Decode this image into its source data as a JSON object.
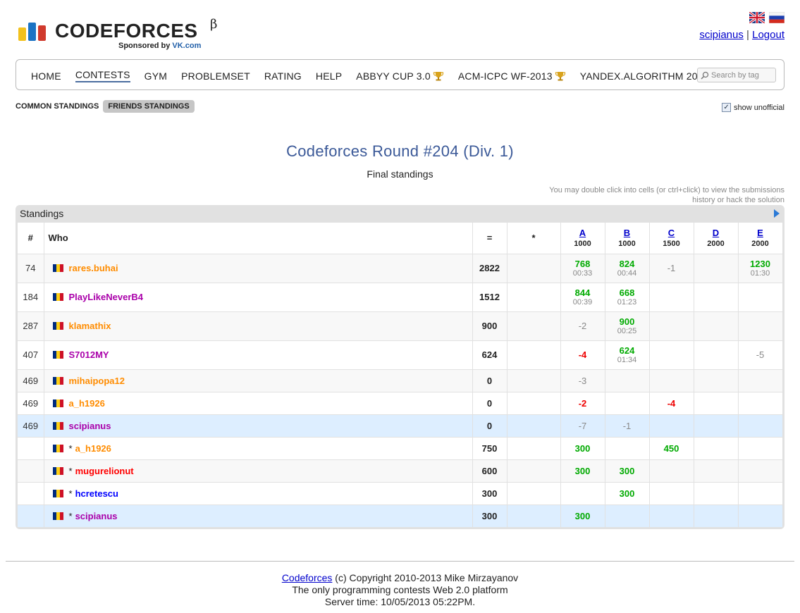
{
  "header": {
    "logo_text": "CODEFORCES",
    "logo_beta": "β",
    "sponsor_prefix": "Sponsored by ",
    "sponsor_brand": "VK.com",
    "user": "scipianus",
    "separator": "|",
    "logout": "Logout"
  },
  "nav": {
    "items": [
      "HOME",
      "CONTESTS",
      "GYM",
      "PROBLEMSET",
      "RATING",
      "HELP",
      "ABBYY CUP 3.0",
      "ACM-ICPC WF-2013",
      "YANDEX.ALGORITHM 2013"
    ],
    "search_placeholder": "Search by tag"
  },
  "subtabs": {
    "common": "COMMON STANDINGS",
    "friends": "FRIENDS STANDINGS",
    "show_unofficial": "show unofficial",
    "checked_mark": "✓"
  },
  "contest": {
    "title": "Codeforces Round #204 (Div. 1)",
    "subtitle": "Final standings",
    "hint": "You may double click into cells (or ctrl+click) to view the submissions history or hack the solution"
  },
  "standings": {
    "box_title": "Standings",
    "headers": {
      "rank": "#",
      "who": "Who",
      "score": "=",
      "hacks": "*",
      "problems": [
        {
          "letter": "A",
          "points": "1000"
        },
        {
          "letter": "B",
          "points": "1000"
        },
        {
          "letter": "C",
          "points": "1500"
        },
        {
          "letter": "D",
          "points": "2000"
        },
        {
          "letter": "E",
          "points": "2000"
        }
      ]
    },
    "rows": [
      {
        "rank": "74",
        "prefix": "",
        "handle": "rares.buhai",
        "score": "2822",
        "hacks": "",
        "cells": [
          {
            "v": "768",
            "t": "00:33"
          },
          {
            "v": "824",
            "t": "00:44"
          },
          {
            "v": "-1"
          },
          {
            "v": ""
          },
          {
            "v": "1230",
            "t": "01:30"
          }
        ]
      },
      {
        "rank": "184",
        "prefix": "",
        "handle": "PlayLikeNeverB4",
        "score": "1512",
        "hacks": "",
        "cells": [
          {
            "v": "844",
            "t": "00:39"
          },
          {
            "v": "668",
            "t": "01:23"
          },
          {
            "v": ""
          },
          {
            "v": ""
          },
          {
            "v": ""
          }
        ]
      },
      {
        "rank": "287",
        "prefix": "",
        "handle": "klamathix",
        "score": "900",
        "hacks": "",
        "cells": [
          {
            "v": "-2"
          },
          {
            "v": "900",
            "t": "00:25"
          },
          {
            "v": ""
          },
          {
            "v": ""
          },
          {
            "v": ""
          }
        ]
      },
      {
        "rank": "407",
        "prefix": "",
        "handle": "S7012MY",
        "score": "624",
        "hacks": "",
        "cells": [
          {
            "v": "-4"
          },
          {
            "v": "624",
            "t": "01:34"
          },
          {
            "v": ""
          },
          {
            "v": ""
          },
          {
            "v": "-5"
          }
        ]
      },
      {
        "rank": "469",
        "prefix": "",
        "handle": "mihaipopa12",
        "score": "0",
        "hacks": "",
        "cells": [
          {
            "v": "-3"
          },
          {
            "v": ""
          },
          {
            "v": ""
          },
          {
            "v": ""
          },
          {
            "v": ""
          }
        ]
      },
      {
        "rank": "469",
        "prefix": "",
        "handle": "a_h1926",
        "score": "0",
        "hacks": "",
        "cells": [
          {
            "v": "-2"
          },
          {
            "v": ""
          },
          {
            "v": "-4"
          },
          {
            "v": ""
          },
          {
            "v": ""
          }
        ]
      },
      {
        "rank": "469",
        "prefix": "",
        "handle": "scipianus",
        "score": "0",
        "hacks": "",
        "cells": [
          {
            "v": "-7"
          },
          {
            "v": "-1"
          },
          {
            "v": ""
          },
          {
            "v": ""
          },
          {
            "v": ""
          }
        ]
      },
      {
        "rank": "",
        "prefix": "*",
        "handle": "a_h1926",
        "score": "750",
        "hacks": "",
        "cells": [
          {
            "v": "300"
          },
          {
            "v": ""
          },
          {
            "v": "450"
          },
          {
            "v": ""
          },
          {
            "v": ""
          }
        ]
      },
      {
        "rank": "",
        "prefix": "*",
        "handle": "mugurelionut",
        "score": "600",
        "hacks": "",
        "cells": [
          {
            "v": "300"
          },
          {
            "v": "300"
          },
          {
            "v": ""
          },
          {
            "v": ""
          },
          {
            "v": ""
          }
        ]
      },
      {
        "rank": "",
        "prefix": "*",
        "handle": "hcretescu",
        "score": "300",
        "hacks": "",
        "cells": [
          {
            "v": ""
          },
          {
            "v": "300"
          },
          {
            "v": ""
          },
          {
            "v": ""
          },
          {
            "v": ""
          }
        ]
      },
      {
        "rank": "",
        "prefix": "*",
        "handle": "scipianus",
        "score": "300",
        "hacks": "",
        "cells": [
          {
            "v": "300"
          },
          {
            "v": ""
          },
          {
            "v": ""
          },
          {
            "v": ""
          },
          {
            "v": ""
          }
        ]
      }
    ]
  },
  "footer": {
    "site_link": "Codeforces",
    "copyright": " (c) Copyright 2010-2013 Mike Mirzayanov",
    "tagline": "The only programming contests Web 2.0 platform",
    "server_time": "Server time: 10/05/2013 05:22PM."
  },
  "colors": {
    "title": "#3b5998",
    "accepted": "#00aa00",
    "rejected": "#888888",
    "rejected_red": "#ee0000",
    "rating_orange": "#ff8c00",
    "rating_violet": "#aa00aa",
    "rating_red": "#ff0000",
    "rating_blue": "#0000ff",
    "highlight_row": "#ddeeff"
  }
}
